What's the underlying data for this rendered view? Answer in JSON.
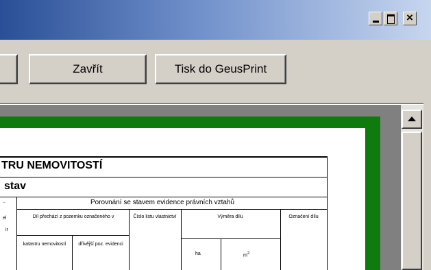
{
  "window": {
    "controls": [
      "minimize",
      "maximize",
      "close"
    ]
  },
  "toolbar": {
    "close_label": "Zavřít",
    "print_label": "Tisk do GeusPrint"
  },
  "document": {
    "heading": "TRU NEMOVITOSTÍ",
    "subheading": "stav",
    "section_title": "Porovnání se stavem evidence právních vztahů",
    "columns": {
      "part_transfer": "Díl přechází z pozemku označeného v",
      "cadastre": "katastru nemovitostí",
      "previous": "dřívější poz. evidenci",
      "ownership_number": "Číslo listu vlastnictví",
      "area": "Výměra dílu",
      "ha": "ha",
      "m2": "m",
      "m2_sup": "2",
      "part_mark": "Označení dílu"
    },
    "left_fragments": [
      "..",
      "el",
      "ir"
    ]
  },
  "colors": {
    "frame_green": "#0f7b0f",
    "face": "#d4d0c8"
  }
}
